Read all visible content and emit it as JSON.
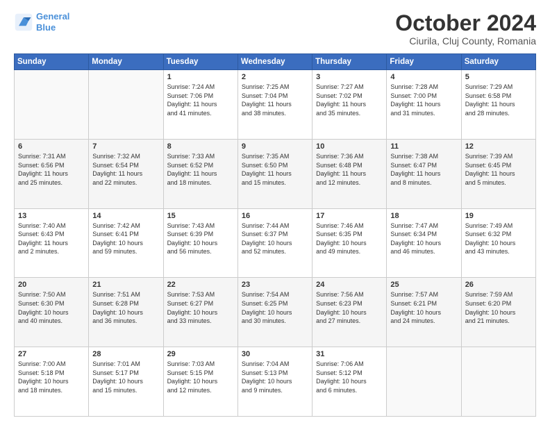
{
  "logo": {
    "line1": "General",
    "line2": "Blue"
  },
  "header": {
    "title": "October 2024",
    "location": "Ciurila, Cluj County, Romania"
  },
  "weekdays": [
    "Sunday",
    "Monday",
    "Tuesday",
    "Wednesday",
    "Thursday",
    "Friday",
    "Saturday"
  ],
  "weeks": [
    [
      {
        "day": "",
        "info": ""
      },
      {
        "day": "",
        "info": ""
      },
      {
        "day": "1",
        "info": "Sunrise: 7:24 AM\nSunset: 7:06 PM\nDaylight: 11 hours\nand 41 minutes."
      },
      {
        "day": "2",
        "info": "Sunrise: 7:25 AM\nSunset: 7:04 PM\nDaylight: 11 hours\nand 38 minutes."
      },
      {
        "day": "3",
        "info": "Sunrise: 7:27 AM\nSunset: 7:02 PM\nDaylight: 11 hours\nand 35 minutes."
      },
      {
        "day": "4",
        "info": "Sunrise: 7:28 AM\nSunset: 7:00 PM\nDaylight: 11 hours\nand 31 minutes."
      },
      {
        "day": "5",
        "info": "Sunrise: 7:29 AM\nSunset: 6:58 PM\nDaylight: 11 hours\nand 28 minutes."
      }
    ],
    [
      {
        "day": "6",
        "info": "Sunrise: 7:31 AM\nSunset: 6:56 PM\nDaylight: 11 hours\nand 25 minutes."
      },
      {
        "day": "7",
        "info": "Sunrise: 7:32 AM\nSunset: 6:54 PM\nDaylight: 11 hours\nand 22 minutes."
      },
      {
        "day": "8",
        "info": "Sunrise: 7:33 AM\nSunset: 6:52 PM\nDaylight: 11 hours\nand 18 minutes."
      },
      {
        "day": "9",
        "info": "Sunrise: 7:35 AM\nSunset: 6:50 PM\nDaylight: 11 hours\nand 15 minutes."
      },
      {
        "day": "10",
        "info": "Sunrise: 7:36 AM\nSunset: 6:48 PM\nDaylight: 11 hours\nand 12 minutes."
      },
      {
        "day": "11",
        "info": "Sunrise: 7:38 AM\nSunset: 6:47 PM\nDaylight: 11 hours\nand 8 minutes."
      },
      {
        "day": "12",
        "info": "Sunrise: 7:39 AM\nSunset: 6:45 PM\nDaylight: 11 hours\nand 5 minutes."
      }
    ],
    [
      {
        "day": "13",
        "info": "Sunrise: 7:40 AM\nSunset: 6:43 PM\nDaylight: 11 hours\nand 2 minutes."
      },
      {
        "day": "14",
        "info": "Sunrise: 7:42 AM\nSunset: 6:41 PM\nDaylight: 10 hours\nand 59 minutes."
      },
      {
        "day": "15",
        "info": "Sunrise: 7:43 AM\nSunset: 6:39 PM\nDaylight: 10 hours\nand 56 minutes."
      },
      {
        "day": "16",
        "info": "Sunrise: 7:44 AM\nSunset: 6:37 PM\nDaylight: 10 hours\nand 52 minutes."
      },
      {
        "day": "17",
        "info": "Sunrise: 7:46 AM\nSunset: 6:35 PM\nDaylight: 10 hours\nand 49 minutes."
      },
      {
        "day": "18",
        "info": "Sunrise: 7:47 AM\nSunset: 6:34 PM\nDaylight: 10 hours\nand 46 minutes."
      },
      {
        "day": "19",
        "info": "Sunrise: 7:49 AM\nSunset: 6:32 PM\nDaylight: 10 hours\nand 43 minutes."
      }
    ],
    [
      {
        "day": "20",
        "info": "Sunrise: 7:50 AM\nSunset: 6:30 PM\nDaylight: 10 hours\nand 40 minutes."
      },
      {
        "day": "21",
        "info": "Sunrise: 7:51 AM\nSunset: 6:28 PM\nDaylight: 10 hours\nand 36 minutes."
      },
      {
        "day": "22",
        "info": "Sunrise: 7:53 AM\nSunset: 6:27 PM\nDaylight: 10 hours\nand 33 minutes."
      },
      {
        "day": "23",
        "info": "Sunrise: 7:54 AM\nSunset: 6:25 PM\nDaylight: 10 hours\nand 30 minutes."
      },
      {
        "day": "24",
        "info": "Sunrise: 7:56 AM\nSunset: 6:23 PM\nDaylight: 10 hours\nand 27 minutes."
      },
      {
        "day": "25",
        "info": "Sunrise: 7:57 AM\nSunset: 6:21 PM\nDaylight: 10 hours\nand 24 minutes."
      },
      {
        "day": "26",
        "info": "Sunrise: 7:59 AM\nSunset: 6:20 PM\nDaylight: 10 hours\nand 21 minutes."
      }
    ],
    [
      {
        "day": "27",
        "info": "Sunrise: 7:00 AM\nSunset: 5:18 PM\nDaylight: 10 hours\nand 18 minutes."
      },
      {
        "day": "28",
        "info": "Sunrise: 7:01 AM\nSunset: 5:17 PM\nDaylight: 10 hours\nand 15 minutes."
      },
      {
        "day": "29",
        "info": "Sunrise: 7:03 AM\nSunset: 5:15 PM\nDaylight: 10 hours\nand 12 minutes."
      },
      {
        "day": "30",
        "info": "Sunrise: 7:04 AM\nSunset: 5:13 PM\nDaylight: 10 hours\nand 9 minutes."
      },
      {
        "day": "31",
        "info": "Sunrise: 7:06 AM\nSunset: 5:12 PM\nDaylight: 10 hours\nand 6 minutes."
      },
      {
        "day": "",
        "info": ""
      },
      {
        "day": "",
        "info": ""
      }
    ]
  ]
}
